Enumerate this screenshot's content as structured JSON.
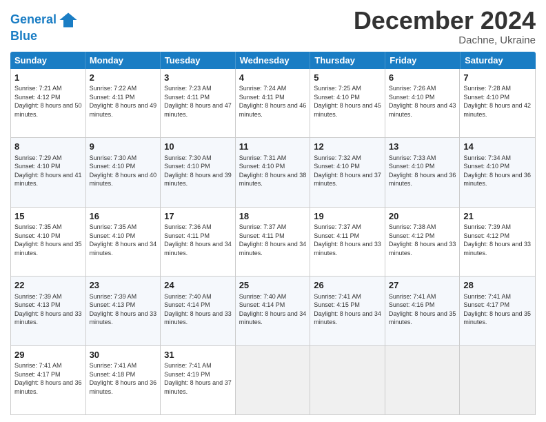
{
  "header": {
    "logo_line1": "General",
    "logo_line2": "Blue",
    "month": "December 2024",
    "location": "Dachne, Ukraine"
  },
  "weekdays": [
    "Sunday",
    "Monday",
    "Tuesday",
    "Wednesday",
    "Thursday",
    "Friday",
    "Saturday"
  ],
  "rows": [
    [
      {
        "day": "1",
        "rise": "7:21 AM",
        "set": "4:12 PM",
        "daylight": "8 hours and 50 minutes."
      },
      {
        "day": "2",
        "rise": "7:22 AM",
        "set": "4:11 PM",
        "daylight": "8 hours and 49 minutes."
      },
      {
        "day": "3",
        "rise": "7:23 AM",
        "set": "4:11 PM",
        "daylight": "8 hours and 47 minutes."
      },
      {
        "day": "4",
        "rise": "7:24 AM",
        "set": "4:11 PM",
        "daylight": "8 hours and 46 minutes."
      },
      {
        "day": "5",
        "rise": "7:25 AM",
        "set": "4:10 PM",
        "daylight": "8 hours and 45 minutes."
      },
      {
        "day": "6",
        "rise": "7:26 AM",
        "set": "4:10 PM",
        "daylight": "8 hours and 43 minutes."
      },
      {
        "day": "7",
        "rise": "7:28 AM",
        "set": "4:10 PM",
        "daylight": "8 hours and 42 minutes."
      }
    ],
    [
      {
        "day": "8",
        "rise": "7:29 AM",
        "set": "4:10 PM",
        "daylight": "8 hours and 41 minutes."
      },
      {
        "day": "9",
        "rise": "7:30 AM",
        "set": "4:10 PM",
        "daylight": "8 hours and 40 minutes."
      },
      {
        "day": "10",
        "rise": "7:30 AM",
        "set": "4:10 PM",
        "daylight": "8 hours and 39 minutes."
      },
      {
        "day": "11",
        "rise": "7:31 AM",
        "set": "4:10 PM",
        "daylight": "8 hours and 38 minutes."
      },
      {
        "day": "12",
        "rise": "7:32 AM",
        "set": "4:10 PM",
        "daylight": "8 hours and 37 minutes."
      },
      {
        "day": "13",
        "rise": "7:33 AM",
        "set": "4:10 PM",
        "daylight": "8 hours and 36 minutes."
      },
      {
        "day": "14",
        "rise": "7:34 AM",
        "set": "4:10 PM",
        "daylight": "8 hours and 36 minutes."
      }
    ],
    [
      {
        "day": "15",
        "rise": "7:35 AM",
        "set": "4:10 PM",
        "daylight": "8 hours and 35 minutes."
      },
      {
        "day": "16",
        "rise": "7:35 AM",
        "set": "4:10 PM",
        "daylight": "8 hours and 34 minutes."
      },
      {
        "day": "17",
        "rise": "7:36 AM",
        "set": "4:11 PM",
        "daylight": "8 hours and 34 minutes."
      },
      {
        "day": "18",
        "rise": "7:37 AM",
        "set": "4:11 PM",
        "daylight": "8 hours and 34 minutes."
      },
      {
        "day": "19",
        "rise": "7:37 AM",
        "set": "4:11 PM",
        "daylight": "8 hours and 33 minutes."
      },
      {
        "day": "20",
        "rise": "7:38 AM",
        "set": "4:12 PM",
        "daylight": "8 hours and 33 minutes."
      },
      {
        "day": "21",
        "rise": "7:39 AM",
        "set": "4:12 PM",
        "daylight": "8 hours and 33 minutes."
      }
    ],
    [
      {
        "day": "22",
        "rise": "7:39 AM",
        "set": "4:13 PM",
        "daylight": "8 hours and 33 minutes."
      },
      {
        "day": "23",
        "rise": "7:39 AM",
        "set": "4:13 PM",
        "daylight": "8 hours and 33 minutes."
      },
      {
        "day": "24",
        "rise": "7:40 AM",
        "set": "4:14 PM",
        "daylight": "8 hours and 33 minutes."
      },
      {
        "day": "25",
        "rise": "7:40 AM",
        "set": "4:14 PM",
        "daylight": "8 hours and 34 minutes."
      },
      {
        "day": "26",
        "rise": "7:41 AM",
        "set": "4:15 PM",
        "daylight": "8 hours and 34 minutes."
      },
      {
        "day": "27",
        "rise": "7:41 AM",
        "set": "4:16 PM",
        "daylight": "8 hours and 35 minutes."
      },
      {
        "day": "28",
        "rise": "7:41 AM",
        "set": "4:17 PM",
        "daylight": "8 hours and 35 minutes."
      }
    ],
    [
      {
        "day": "29",
        "rise": "7:41 AM",
        "set": "4:17 PM",
        "daylight": "8 hours and 36 minutes."
      },
      {
        "day": "30",
        "rise": "7:41 AM",
        "set": "4:18 PM",
        "daylight": "8 hours and 36 minutes."
      },
      {
        "day": "31",
        "rise": "7:41 AM",
        "set": "4:19 PM",
        "daylight": "8 hours and 37 minutes."
      },
      null,
      null,
      null,
      null
    ]
  ]
}
